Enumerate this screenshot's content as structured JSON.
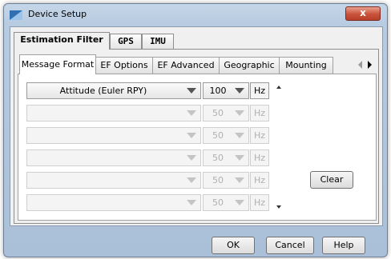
{
  "window": {
    "title": "Device Setup",
    "close_label": "x"
  },
  "top_tabs": [
    {
      "label": "Estimation Filter",
      "active": true
    },
    {
      "label": "GPS",
      "active": false
    },
    {
      "label": "IMU",
      "active": false
    }
  ],
  "sub_tabs": [
    {
      "label": "Message Format",
      "active": true
    },
    {
      "label": "EF Options",
      "active": false
    },
    {
      "label": "EF Advanced",
      "active": false
    },
    {
      "label": "Geographic",
      "active": false
    },
    {
      "label": "Mounting",
      "active": false
    }
  ],
  "rows": [
    {
      "message": "Attitude (Euler RPY)",
      "rate": "100",
      "unit": "Hz",
      "enabled": true
    },
    {
      "message": "",
      "rate": "50",
      "unit": "Hz",
      "enabled": false
    },
    {
      "message": "",
      "rate": "50",
      "unit": "Hz",
      "enabled": false
    },
    {
      "message": "",
      "rate": "50",
      "unit": "Hz",
      "enabled": false
    },
    {
      "message": "",
      "rate": "50",
      "unit": "Hz",
      "enabled": false
    },
    {
      "message": "",
      "rate": "50",
      "unit": "Hz",
      "enabled": false
    }
  ],
  "buttons": {
    "clear": "Clear",
    "ok": "OK",
    "cancel": "Cancel",
    "help": "Help"
  },
  "icons": {
    "title": "app-icon",
    "tab_scroll_left": "arrow-left-icon",
    "tab_scroll_right": "arrow-right-icon",
    "dropdown": "chevron-down-icon",
    "scroll_up": "scroll-up-icon",
    "scroll_down": "scroll-down-icon"
  },
  "colors": {
    "title_bar": "#b7cbe1",
    "close_button": "#c9523a",
    "disabled_text": "#b0b0b0"
  }
}
